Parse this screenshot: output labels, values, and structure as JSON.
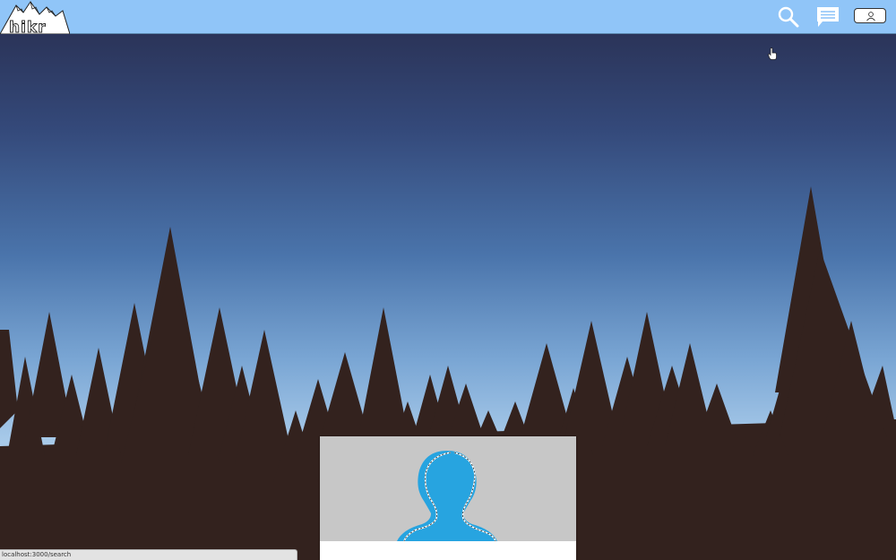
{
  "navbar": {
    "logo_text": "hikr",
    "icons": {
      "search": "search-icon",
      "messages": "message-icon",
      "profile": "user-icon"
    }
  },
  "status_bar": {
    "url": "localhost:3000/search"
  },
  "colors": {
    "navbar_bg": "#90c5f8",
    "sky_top": "#2b3459",
    "sky_bottom": "#9fc7ea",
    "trees": "#33221e",
    "avatar_bg": "#c7c7c7",
    "avatar_figure": "#27a4e0"
  }
}
